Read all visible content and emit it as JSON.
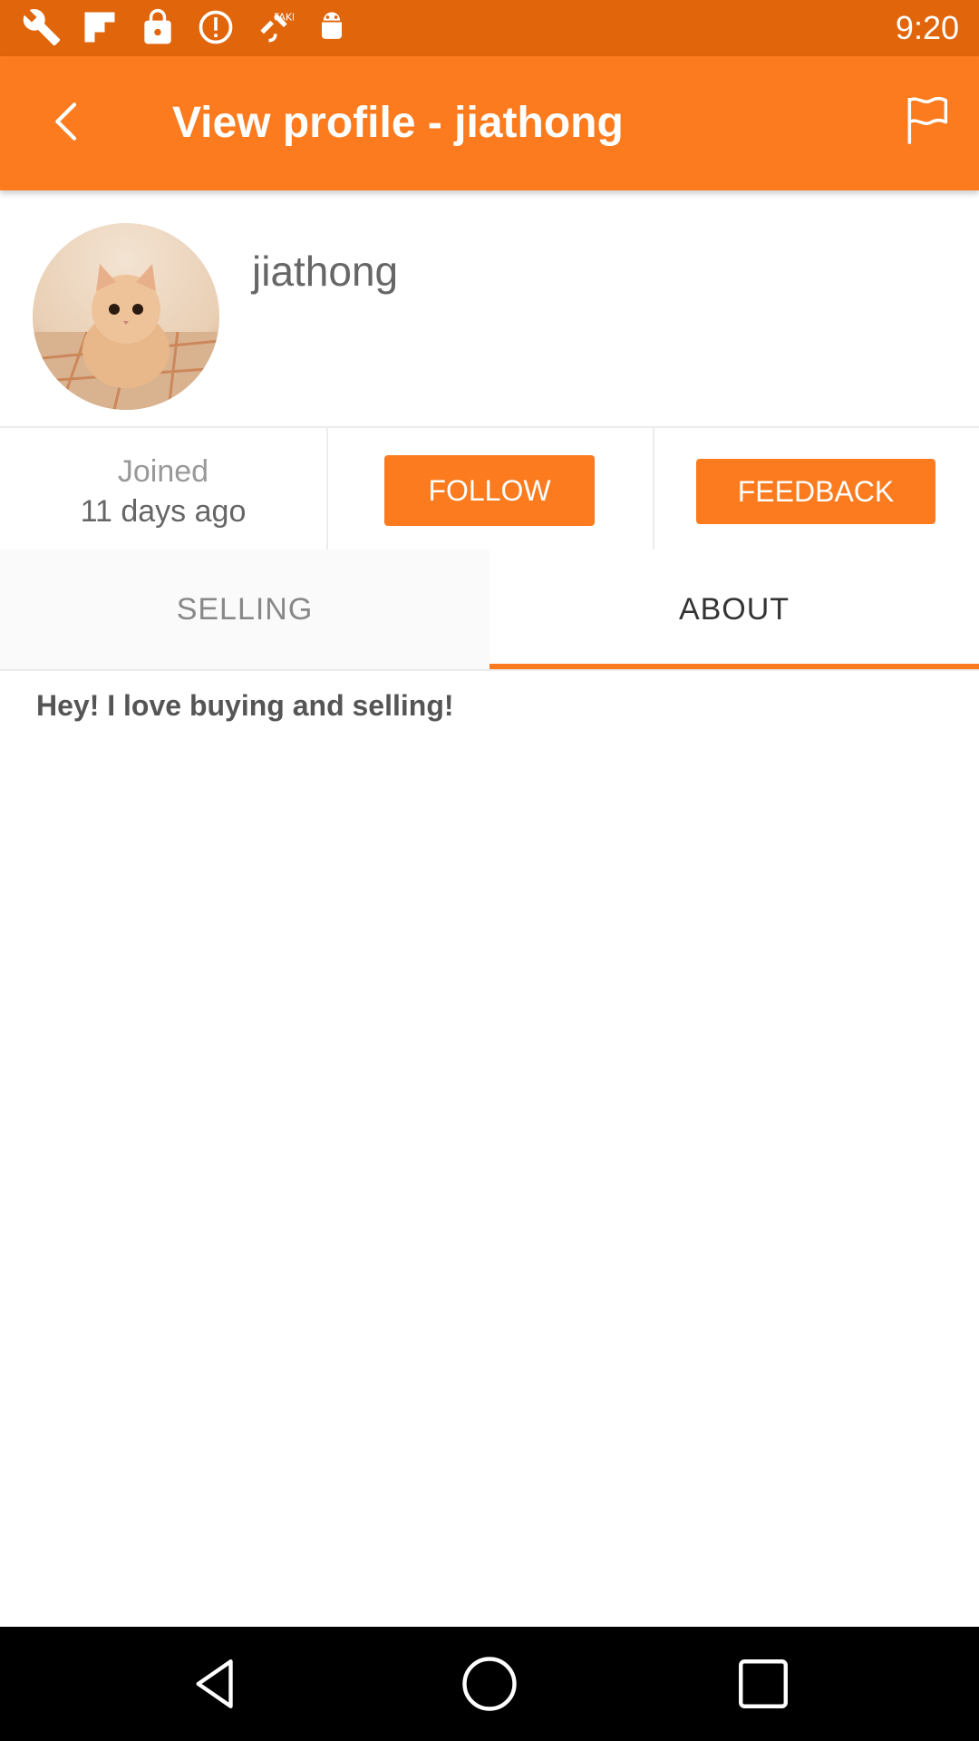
{
  "status_bar": {
    "time": "9:20",
    "icons": [
      "wrench-icon",
      "flipboard-icon",
      "lock-icon",
      "alert-icon",
      "fake-gps-icon",
      "android-icon"
    ]
  },
  "app_bar": {
    "title": "View profile - jiathong",
    "back_icon": "back-arrow-icon",
    "report_icon": "flag-icon"
  },
  "profile": {
    "username": "jiathong",
    "avatar": "kitten-photo"
  },
  "stats": {
    "joined_label": "Joined",
    "joined_value": "11 days ago",
    "follow_label": "FOLLOW",
    "feedback_label": "FEEDBACK"
  },
  "tabs": [
    {
      "label": "SELLING",
      "selected": false
    },
    {
      "label": "ABOUT",
      "selected": true
    }
  ],
  "about": {
    "text": "Hey! I love buying and selling!"
  },
  "nav_bar": {
    "icons": [
      "nav-back-icon",
      "nav-home-icon",
      "nav-recents-icon"
    ]
  },
  "colors": {
    "status_bar": "#e1650a",
    "accent": "#fb7b1e",
    "text_muted": "#999999"
  }
}
